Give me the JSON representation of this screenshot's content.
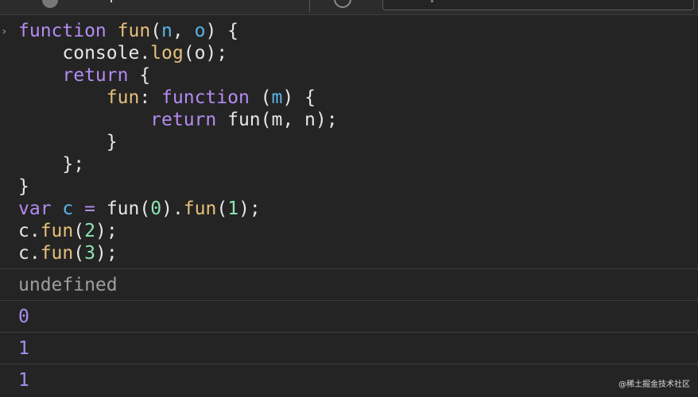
{
  "console": {
    "prompt_icon": "chevron-right-icon",
    "input_lines": [
      [
        {
          "t": "function",
          "c": "kw"
        },
        {
          "t": " ",
          "c": "pl"
        },
        {
          "t": "fun",
          "c": "fn"
        },
        {
          "t": "(",
          "c": "pl"
        },
        {
          "t": "n",
          "c": "pm"
        },
        {
          "t": ", ",
          "c": "pl"
        },
        {
          "t": "o",
          "c": "pm"
        },
        {
          "t": ") {",
          "c": "pl"
        }
      ],
      [
        {
          "t": "    console.",
          "c": "pl"
        },
        {
          "t": "log",
          "c": "fn"
        },
        {
          "t": "(o);",
          "c": "pl"
        }
      ],
      [
        {
          "t": "    ",
          "c": "pl"
        },
        {
          "t": "return",
          "c": "kw"
        },
        {
          "t": " {",
          "c": "pl"
        }
      ],
      [
        {
          "t": "        ",
          "c": "pl"
        },
        {
          "t": "fun",
          "c": "fn"
        },
        {
          "t": ": ",
          "c": "pl"
        },
        {
          "t": "function",
          "c": "kw"
        },
        {
          "t": " (",
          "c": "pl"
        },
        {
          "t": "m",
          "c": "pm"
        },
        {
          "t": ") {",
          "c": "pl"
        }
      ],
      [
        {
          "t": "            ",
          "c": "pl"
        },
        {
          "t": "return",
          "c": "kw"
        },
        {
          "t": " fun(m, n);",
          "c": "pl"
        }
      ],
      [
        {
          "t": "        }",
          "c": "pl"
        }
      ],
      [
        {
          "t": "    };",
          "c": "pl"
        }
      ],
      [
        {
          "t": "}",
          "c": "pl"
        }
      ],
      [
        {
          "t": "var",
          "c": "kw"
        },
        {
          "t": " ",
          "c": "pl"
        },
        {
          "t": "c",
          "c": "pm"
        },
        {
          "t": " ",
          "c": "pl"
        },
        {
          "t": "=",
          "c": "kw"
        },
        {
          "t": " fun(",
          "c": "pl"
        },
        {
          "t": "0",
          "c": "num"
        },
        {
          "t": ").",
          "c": "pl"
        },
        {
          "t": "fun",
          "c": "fn"
        },
        {
          "t": "(",
          "c": "pl"
        },
        {
          "t": "1",
          "c": "num"
        },
        {
          "t": ");",
          "c": "pl"
        }
      ],
      [
        {
          "t": "c.",
          "c": "pl"
        },
        {
          "t": "fun",
          "c": "fn"
        },
        {
          "t": "(",
          "c": "pl"
        },
        {
          "t": "2",
          "c": "num"
        },
        {
          "t": ");",
          "c": "pl"
        }
      ],
      [
        {
          "t": "c.",
          "c": "pl"
        },
        {
          "t": "fun",
          "c": "fn"
        },
        {
          "t": "(",
          "c": "pl"
        },
        {
          "t": "3",
          "c": "num"
        },
        {
          "t": ");",
          "c": "pl"
        }
      ]
    ],
    "outputs": [
      {
        "text": "undefined",
        "kind": "undefined"
      },
      {
        "text": "0",
        "kind": "number"
      },
      {
        "text": "1",
        "kind": "number"
      },
      {
        "text": "1",
        "kind": "number"
      }
    ]
  },
  "watermark": "@稀土掘金技术社区",
  "colors": {
    "background": "#242424",
    "keyword": "#b38cf2",
    "function_name": "#e5c07b",
    "parameter": "#5ab4e8",
    "number_literal": "#8ee6b4",
    "undefined_output": "#9e9e9e",
    "number_output": "#a590f0"
  }
}
